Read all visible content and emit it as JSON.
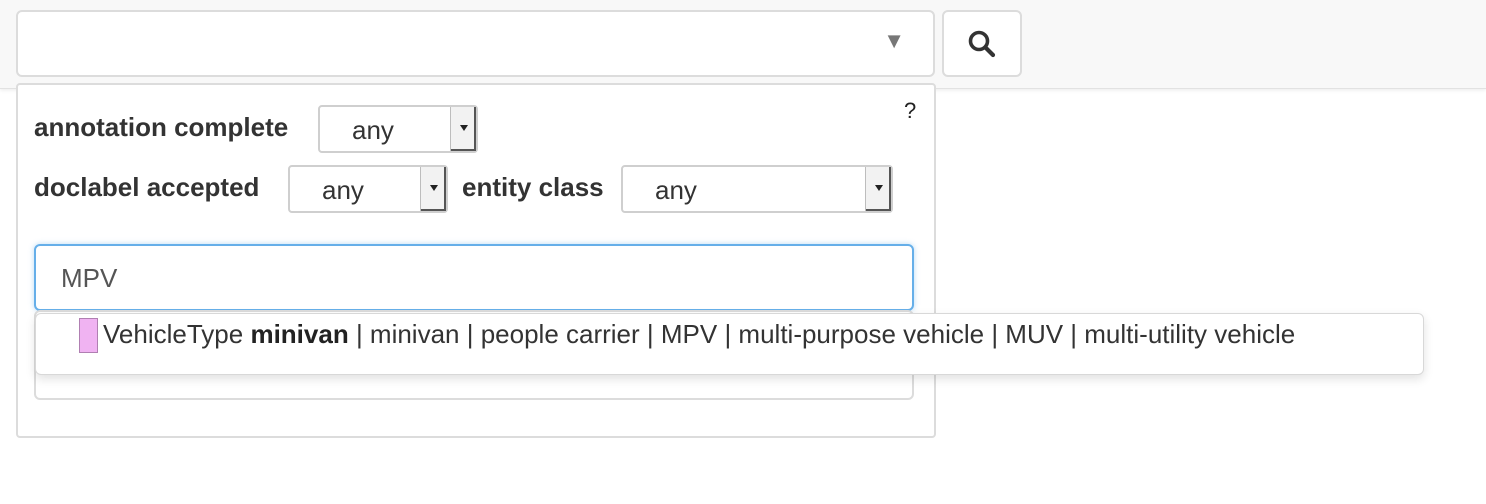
{
  "search_bar": {
    "caret_glyph": "▼",
    "search_icon": "search-icon"
  },
  "panel": {
    "help_label": "?",
    "filters": {
      "annotation_complete": {
        "label": "annotation complete",
        "value": "any"
      },
      "doclabel_accepted": {
        "label": "doclabel accepted",
        "value": "any"
      },
      "entity_class": {
        "label": "entity class",
        "value": "any"
      }
    },
    "query_input": {
      "value": "MPV"
    }
  },
  "suggestion": {
    "swatch_color": "#f0b3f2",
    "class_name": "VehicleType",
    "entity_name": "minivan",
    "synonyms": "| minivan | people carrier | MPV | multi-purpose vehicle | MUV | multi-utility vehicle"
  }
}
